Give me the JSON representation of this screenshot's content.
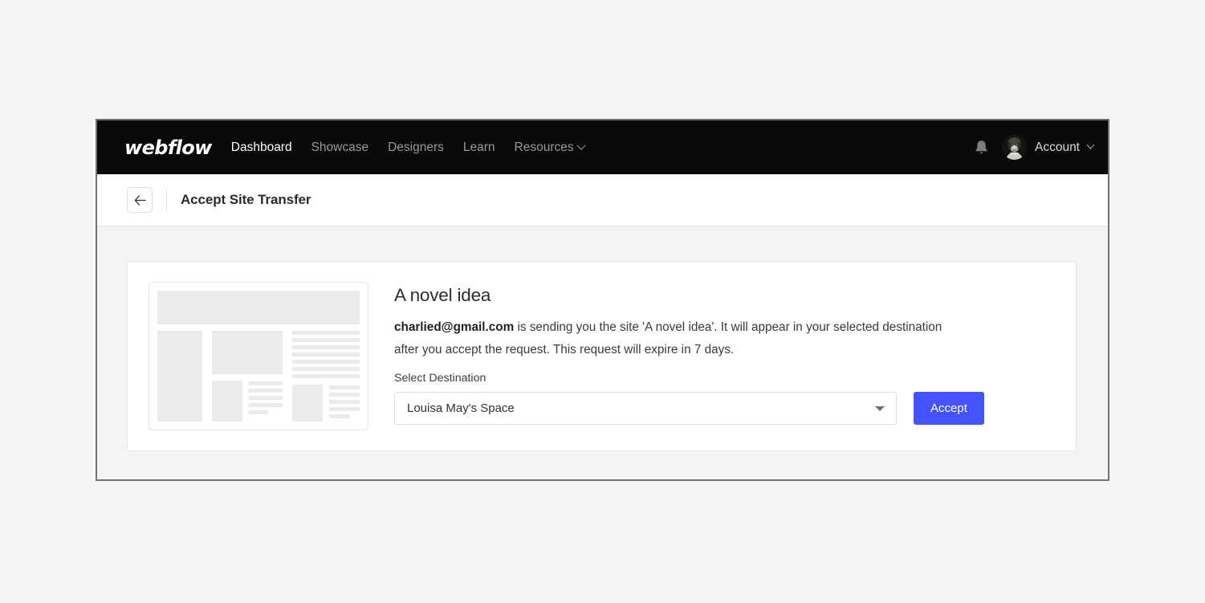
{
  "navbar": {
    "logo": "webflow",
    "links": [
      {
        "label": "Dashboard",
        "active": true,
        "has_chevron": false
      },
      {
        "label": "Showcase",
        "active": false,
        "has_chevron": false
      },
      {
        "label": "Designers",
        "active": false,
        "has_chevron": false
      },
      {
        "label": "Learn",
        "active": false,
        "has_chevron": false
      },
      {
        "label": "Resources",
        "active": false,
        "has_chevron": true
      }
    ],
    "notifications_icon": "bell-icon",
    "account_label": "Account",
    "avatar_icon": "user-avatar-photo",
    "background_color": "#0a0a0a"
  },
  "subheader": {
    "back_label": "←",
    "title": "Accept Site Transfer"
  },
  "transfer": {
    "site_name": "A novel idea",
    "sender_email": "charlied@gmail.com",
    "description_rest": " is sending you the site 'A novel idea'. It will appear in your selected destination after you accept the request. This request will expire in 7 days.",
    "destination_label": "Select Destination",
    "destination_value": "Louisa May's Space",
    "accept_label": "Accept",
    "accent_color": "#4353ff",
    "thumbnail_icon": "site-placeholder-thumbnail"
  }
}
